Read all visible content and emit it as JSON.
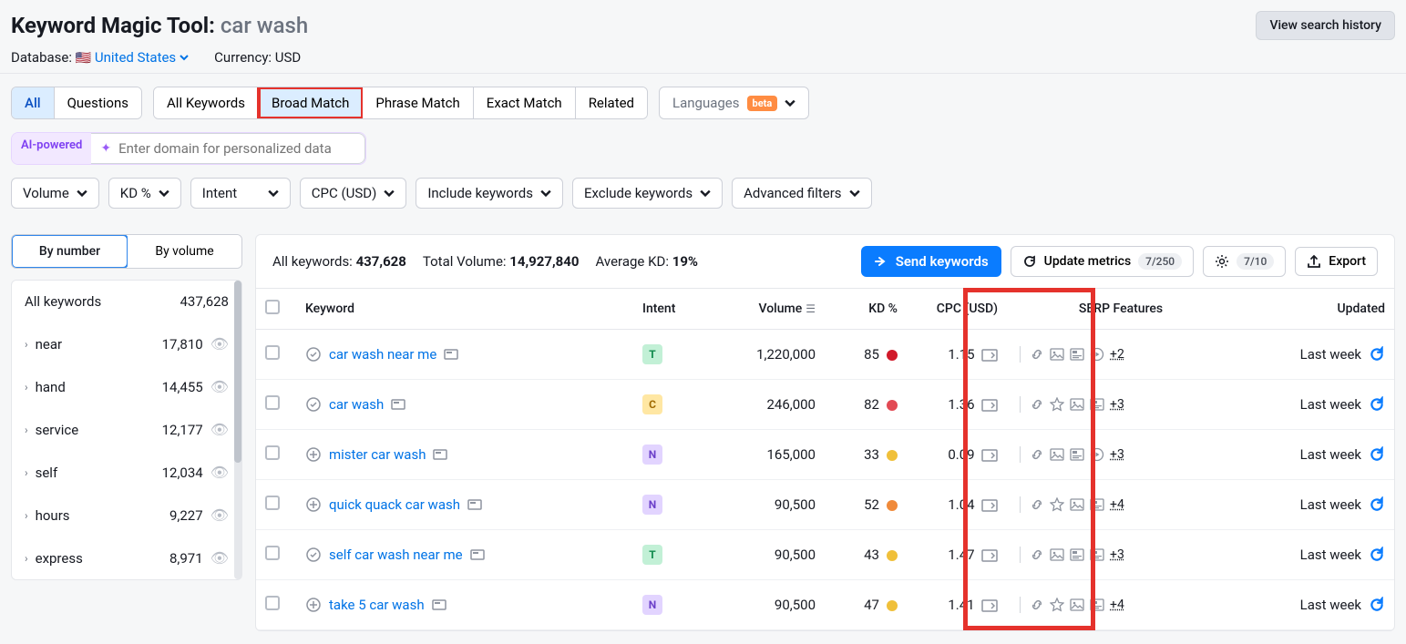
{
  "header": {
    "title": "Keyword Magic Tool:",
    "keyword": "car wash",
    "history_btn": "View search history",
    "database_label": "Database:",
    "database_value": "United States",
    "currency_label": "Currency:",
    "currency_value": "USD"
  },
  "tabs": {
    "mode": [
      "All",
      "Questions"
    ],
    "match": [
      "All Keywords",
      "Broad Match",
      "Phrase Match",
      "Exact Match",
      "Related"
    ],
    "languages_label": "Languages",
    "beta": "beta"
  },
  "ai": {
    "badge": "AI-powered",
    "placeholder": "Enter domain for personalized data"
  },
  "filters": {
    "volume": "Volume",
    "kd": "KD %",
    "intent": "Intent",
    "cpc": "CPC (USD)",
    "include": "Include keywords",
    "exclude": "Exclude keywords",
    "advanced": "Advanced filters"
  },
  "sidebar": {
    "by_number": "By number",
    "by_volume": "By volume",
    "all_label": "All keywords",
    "all_count": "437,628",
    "items": [
      {
        "name": "near",
        "count": "17,810"
      },
      {
        "name": "hand",
        "count": "14,455"
      },
      {
        "name": "service",
        "count": "12,177"
      },
      {
        "name": "self",
        "count": "12,034"
      },
      {
        "name": "hours",
        "count": "9,227"
      },
      {
        "name": "express",
        "count": "8,971"
      }
    ]
  },
  "summary": {
    "all_label": "All keywords:",
    "all_val": "437,628",
    "vol_label": "Total Volume:",
    "vol_val": "14,927,840",
    "kd_label": "Average KD:",
    "kd_val": "19%",
    "send_btn": "Send keywords",
    "update_btn": "Update metrics",
    "update_count": "7/250",
    "gear_count": "7/10",
    "export_btn": "Export"
  },
  "columns": {
    "keyword": "Keyword",
    "intent": "Intent",
    "volume": "Volume",
    "kd": "KD %",
    "cpc": "CPC (USD)",
    "serp": "SERP Features",
    "updated": "Updated"
  },
  "rows": [
    {
      "kw": "car wash near me",
      "icon": "ring",
      "intent": "T",
      "volume": "1,220,000",
      "kd": "85",
      "kdclass": "kd-85",
      "cpc": "1.15",
      "more": "+2",
      "updated": "Last week"
    },
    {
      "kw": "car wash",
      "icon": "ring",
      "intent": "C",
      "volume": "246,000",
      "kd": "82",
      "kdclass": "kd-82",
      "cpc": "1.36",
      "more": "+3",
      "updated": "Last week"
    },
    {
      "kw": "mister car wash",
      "icon": "plus",
      "intent": "N",
      "volume": "165,000",
      "kd": "33",
      "kdclass": "kd-33",
      "cpc": "0.09",
      "more": "+3",
      "updated": "Last week"
    },
    {
      "kw": "quick quack car wash",
      "icon": "plus",
      "intent": "N",
      "volume": "90,500",
      "kd": "52",
      "kdclass": "kd-52",
      "cpc": "1.04",
      "more": "+4",
      "updated": "Last week"
    },
    {
      "kw": "self car wash near me",
      "icon": "ring",
      "intent": "T",
      "volume": "90,500",
      "kd": "43",
      "kdclass": "kd-43",
      "cpc": "1.47",
      "more": "+3",
      "updated": "Last week"
    },
    {
      "kw": "take 5 car wash",
      "icon": "plus",
      "intent": "N",
      "volume": "90,500",
      "kd": "47",
      "kdclass": "kd-47",
      "cpc": "1.41",
      "more": "+4",
      "updated": "Last week"
    }
  ]
}
